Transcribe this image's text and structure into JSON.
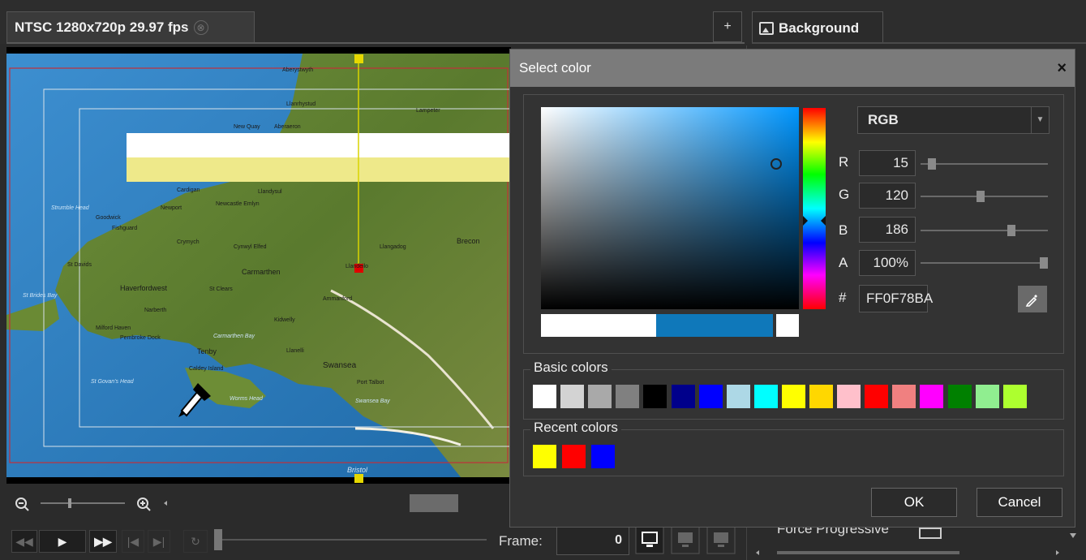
{
  "tabs": {
    "preview_label": "NTSC 1280x720p 29.97 fps",
    "close_glyph": "⊗",
    "add_glyph": "+",
    "background_label": "Background"
  },
  "map_labels": {
    "aberystwyth": "Aberystwyth",
    "llanrhystud": "Llanrhystud",
    "aberaeron": "Aberaeron",
    "newquay": "New Quay",
    "lampeter": "Lampeter",
    "cardigan": "Cardigan",
    "llandysul": "Llandysul",
    "newcastle_emlyn": "Newcastle Emlyn",
    "newport": "Newport",
    "fishguard": "Fishguard",
    "strumble": "Strumble Head",
    "goodwick": "Goodwick",
    "crymych": "Crymych",
    "cynwyl": "Cynwyl Elfed",
    "llandeilo": "Llandeilo",
    "llangadog": "Llangadog",
    "brecon": "Brecon",
    "carmarthen": "Carmarthen",
    "haverfordwest": "Haverfordwest",
    "st_davids": "St Davids",
    "st_brides": "St Brides Bay",
    "narberth": "Narberth",
    "st_clears": "St Clears",
    "ammanford": "Ammanford",
    "kidwelly": "Kidwelly",
    "milford": "Milford Haven",
    "pembroke": "Pembroke Dock",
    "carm_bay": "Carmarthen Bay",
    "tenby": "Tenby",
    "llanelli": "Llanelli",
    "swansea": "Swansea",
    "port_talbot": "Port Talbot",
    "swansea_bay": "Swansea Bay",
    "caldey": "Caldey Island",
    "worms": "Worms Head",
    "st_govans": "St Govan's Head",
    "bristol": "Bristol"
  },
  "playback": {
    "frame_label": "Frame:",
    "frame_value": "0"
  },
  "right_panel": {
    "force_progressive_label": "Force Progressive"
  },
  "dialog": {
    "title": "Select color",
    "close_glyph": "×",
    "mode": "RGB",
    "channels": [
      {
        "label": "R",
        "value": "15"
      },
      {
        "label": "G",
        "value": "120"
      },
      {
        "label": "B",
        "value": "186"
      },
      {
        "label": "A",
        "value": "100%"
      }
    ],
    "slider_levels": [
      0.059,
      0.471,
      0.729,
      1.0
    ],
    "hex_label": "#",
    "hex_value": "FF0F78BA",
    "basic_colors_label": "Basic colors",
    "basic_colors": [
      "#ffffff",
      "#d3d3d3",
      "#a9a9a9",
      "#808080",
      "#000000",
      "#00008b",
      "#0000ff",
      "#add8e6",
      "#00ffff",
      "#ffff00",
      "#ffd700",
      "#ffc0cb",
      "#ff0000",
      "#f08080",
      "#ff00ff",
      "#008000",
      "#90ee90",
      "#adff2f"
    ],
    "recent_colors_label": "Recent colors",
    "recent_colors": [
      "#ffff00",
      "#ff0000",
      "#0000ff"
    ],
    "ok_label": "OK",
    "cancel_label": "Cancel",
    "current_color": "#0f78ba"
  }
}
